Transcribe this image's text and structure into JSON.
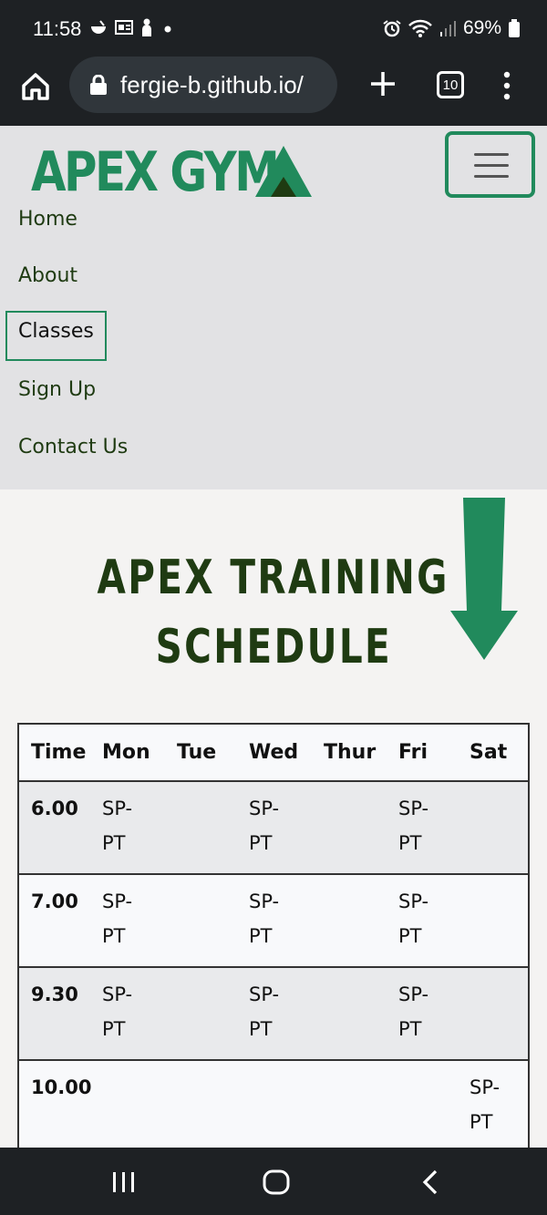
{
  "status_bar": {
    "time": "11:58",
    "battery": "69%",
    "icons": [
      "notification-icon",
      "news-icon",
      "person-icon",
      "dot-icon",
      "alarm-icon",
      "wifi-icon",
      "signal-icon",
      "battery-icon"
    ]
  },
  "browser": {
    "url": "fergie-b.github.io/",
    "tab_count": "10"
  },
  "site": {
    "logo_text": "APEX GYM",
    "nav": [
      {
        "label": "Home"
      },
      {
        "label": "About"
      },
      {
        "label": "Classes"
      },
      {
        "label": "Sign Up"
      },
      {
        "label": "Contact Us"
      }
    ],
    "heading_line1": "APEX TRAINING",
    "heading_line2": "SCHEDULE"
  },
  "schedule": {
    "columns": [
      "Time",
      "Mon",
      "Tue",
      "Wed",
      "Thur",
      "Fri",
      "Sat"
    ],
    "rows": [
      {
        "time": "6.00",
        "Mon": "SP-PT",
        "Tue": "",
        "Wed": "SP-PT",
        "Thur": "",
        "Fri": "SP-PT",
        "Sat": ""
      },
      {
        "time": "7.00",
        "Mon": "SP-PT",
        "Tue": "",
        "Wed": "SP-PT",
        "Thur": "",
        "Fri": "SP-PT",
        "Sat": ""
      },
      {
        "time": "9.30",
        "Mon": "SP-PT",
        "Tue": "",
        "Wed": "SP-PT",
        "Thur": "",
        "Fri": "SP-PT",
        "Sat": ""
      },
      {
        "time": "10.00",
        "Mon": "",
        "Tue": "",
        "Wed": "",
        "Thur": "",
        "Fri": "",
        "Sat": "SP-PT"
      }
    ]
  },
  "colors": {
    "brand_green": "#218a5c",
    "dark_green": "#1f3b12",
    "header_bg": "#e2e2e4",
    "page_bg": "#f4f3f2",
    "chrome_bg": "#1e2124"
  }
}
